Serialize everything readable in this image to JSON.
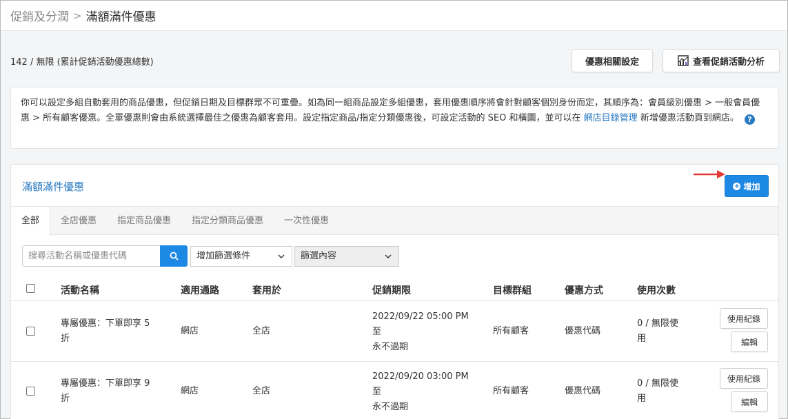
{
  "breadcrumb": {
    "parent": "促銷及分潤",
    "separator": ">",
    "current": "滿額滿件優惠"
  },
  "summary": "142 / 無限 (累計促銷活動優惠總數)",
  "header_buttons": {
    "settings": "優惠相關設定",
    "analytics": "查看促銷活動分析"
  },
  "notice": {
    "text_before_link": "你可以設定多組自動套用的商品優惠，但促銷日期及目標群眾不可重疊。如為同一組商品設定多組優惠，套用優惠順序將會針對顧客個別身份而定，其順序為：會員級別優惠 > 一般會員優惠 > 所有顧客優惠。全單優惠則會由系統選擇最佳之優惠為顧客套用。設定指定商品/指定分類優惠後，可設定活動的 SEO 和橫圖，並可以在",
    "link": "網店目錄管理",
    "text_after_link": "新增優惠活動頁到網店。",
    "help_icon": "?"
  },
  "panel": {
    "title": "滿額滿件優惠",
    "add_button": "增加",
    "tabs": [
      "全部",
      "全店優惠",
      "指定商品優惠",
      "指定分類商品優惠",
      "一次性優惠"
    ],
    "search_placeholder": "搜尋活動名稱或優惠代碼",
    "filter_select": "增加篩選條件",
    "content_select": "篩選內容",
    "columns": [
      "活動名稱",
      "適用通路",
      "套用於",
      "促銷期限",
      "目標群組",
      "優惠方式",
      "使用次數"
    ],
    "rows": [
      {
        "name_line1": "專屬優惠：下單即享 5",
        "name_line2": "折",
        "channel": "網店",
        "applies_to": "全店",
        "period_start": "2022/09/22 05:00 PM",
        "period_to": "至",
        "period_end": "永不過期",
        "target": "所有顧客",
        "method": "優惠代碼",
        "usage_line1": "0 / 無限使",
        "usage_line2": "用",
        "log_button": "使用紀錄",
        "edit_button": "編輯"
      },
      {
        "name_line1": "專屬優惠：下單即享 9",
        "name_line2": "折",
        "channel": "網店",
        "applies_to": "全店",
        "period_start": "2022/09/20 03:00 PM",
        "period_to": "至",
        "period_end": "永不過期",
        "target": "所有顧客",
        "method": "優惠代碼",
        "usage_line1": "0 / 無限使",
        "usage_line2": "用",
        "log_button": "使用紀錄",
        "edit_button": "編輯"
      }
    ]
  },
  "colors": {
    "accent": "#1e88e5",
    "link": "#2a7ac2",
    "arrow": "#e53935"
  }
}
